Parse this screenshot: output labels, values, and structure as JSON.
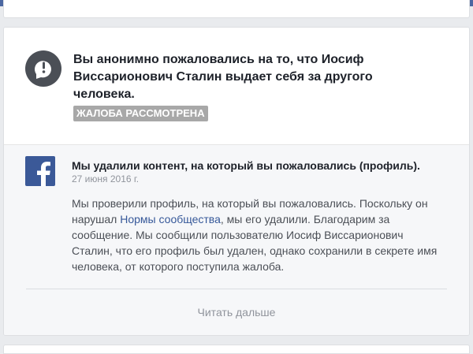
{
  "report": {
    "title": "Вы анонимно пожаловались на то, что Иосиф Виссарионович Сталин выдает себя за другого человека.",
    "status": "ЖАЛОБА РАССМОТРЕНА",
    "icon": "exclamation-icon"
  },
  "message": {
    "heading": "Мы удалили контент, на который вы пожаловались (профиль).",
    "date": "27 июня 2016 г.",
    "body_part1": "Мы проверили профиль, на который вы пожаловались. Поскольку он нарушал ",
    "link_text": "Нормы сообщества",
    "body_part2": ", мы его удалили. Благодарим за сообщение. Мы сообщили пользователю Иосиф Виссарионович Сталин, что его профиль был удален, однако сохранили в секрете имя человека, от которого поступила жалоба.",
    "icon": "facebook-logo-icon"
  },
  "read_more_label": "Читать дальше",
  "colors": {
    "brand": "#3b5998",
    "link": "#365899",
    "badge": "#a8a8a8"
  }
}
